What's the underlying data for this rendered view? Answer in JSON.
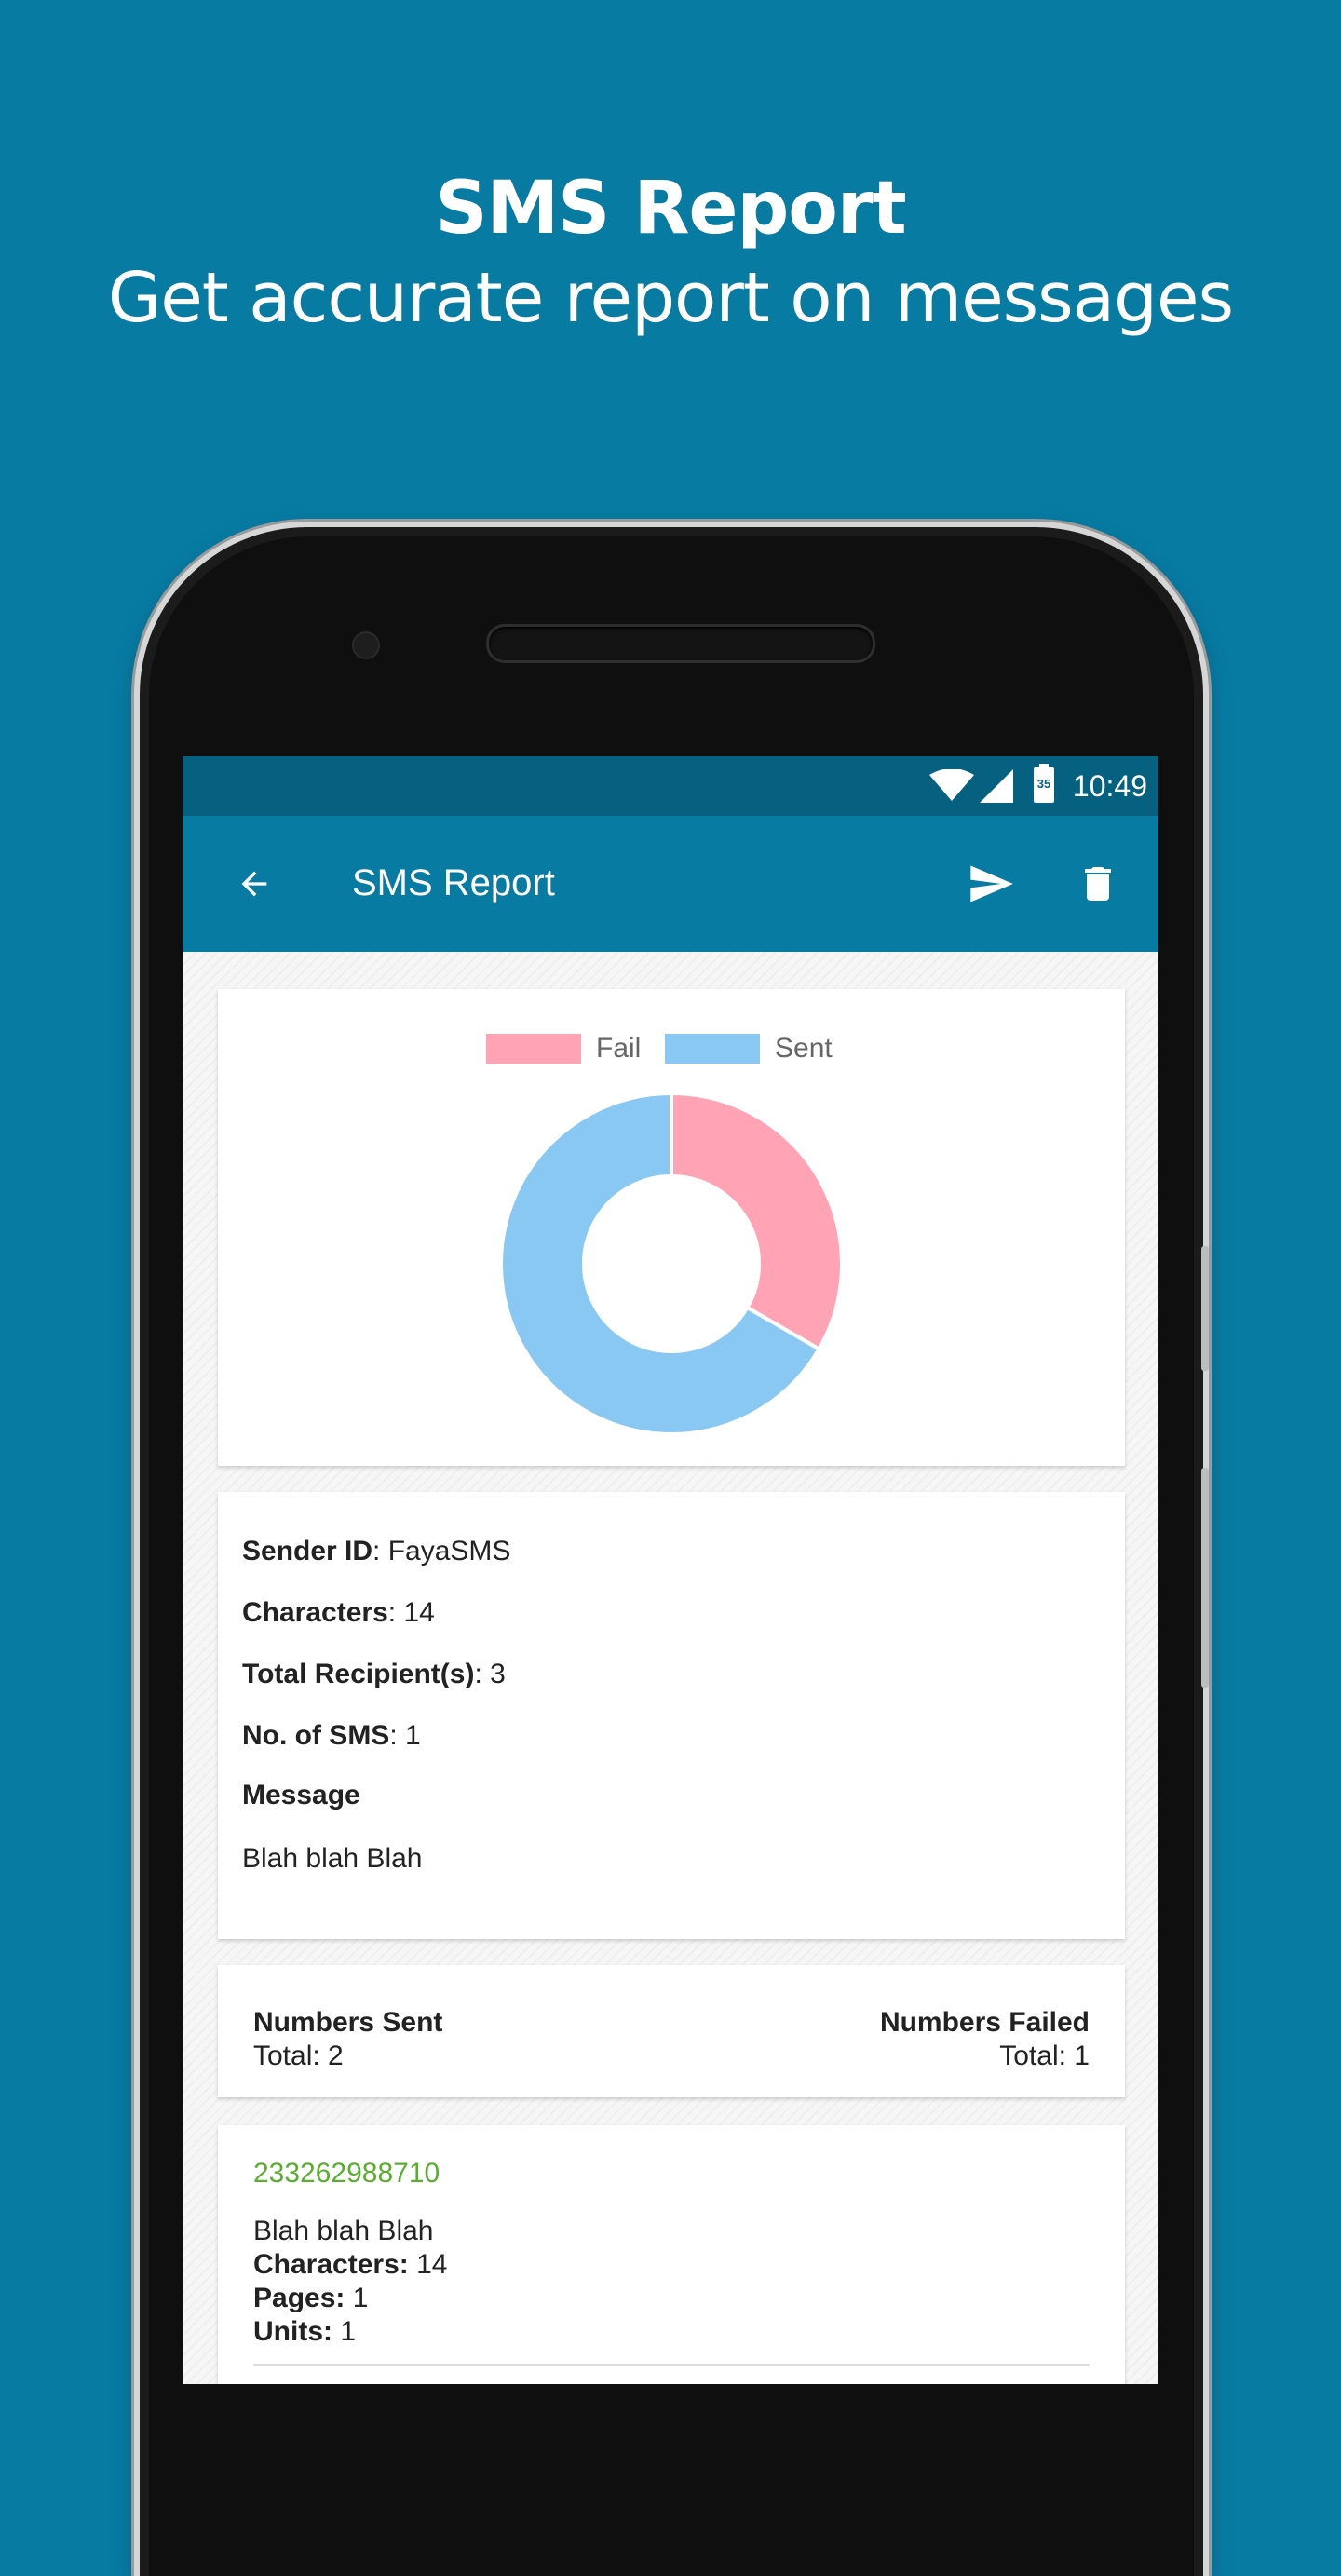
{
  "promo": {
    "title": "SMS Report",
    "subtitle": "Get accurate report on messages"
  },
  "status_bar": {
    "time": "10:49",
    "battery_level": "35",
    "icons": [
      "wifi-icon",
      "signal-icon",
      "battery-icon"
    ]
  },
  "app_bar": {
    "title": "SMS Report",
    "icons": [
      "back-arrow-icon",
      "send-icon",
      "delete-icon"
    ]
  },
  "chart_data": {
    "type": "pie",
    "legend": [
      "Fail",
      "Sent"
    ],
    "values": [
      1,
      2
    ],
    "colors": [
      "#ffa3b5",
      "#89c8f2"
    ],
    "legend_position": "top"
  },
  "details": {
    "sender_label": "Sender ID",
    "sender_value": ": FayaSMS",
    "characters_label": "Characters",
    "characters_value": ": 14",
    "recipients_label": "Total Recipient(s)",
    "recipients_value": ": 3",
    "nosms_label": "No. of SMS",
    "nosms_value": ": 1",
    "message_label": "Message",
    "message_value": "Blah blah Blah"
  },
  "numbers": {
    "sent_label": "Numbers Sent",
    "sent_total": "Total: 2",
    "failed_label": "Numbers Failed",
    "failed_total": "Total: 1"
  },
  "entries": [
    {
      "number": "233262988710",
      "message": "Blah blah Blah",
      "characters_label": "Characters:",
      "characters_value": " 14",
      "pages_label": "Pages:",
      "pages_value": " 1",
      "units_label": "Units:",
      "units_value": " 1"
    }
  ],
  "colors": {
    "background": "#087ba3",
    "status_bar": "#066080",
    "app_bar": "#087ba3",
    "number_green": "#5aae2e"
  }
}
